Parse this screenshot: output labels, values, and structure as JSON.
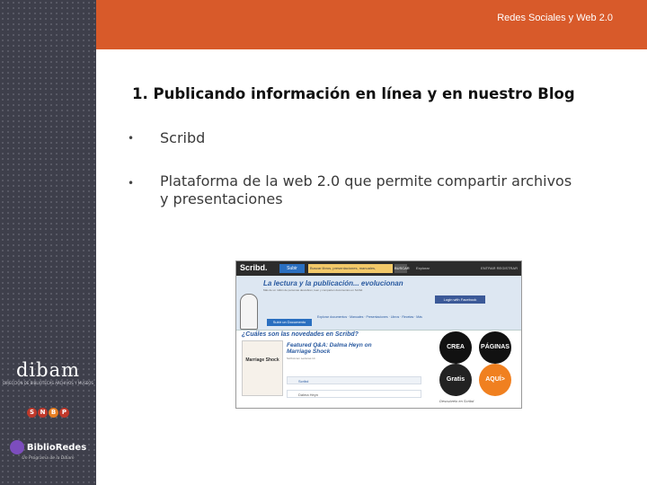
{
  "header": {
    "title": "Redes Sociales y Web 2.0"
  },
  "slide": {
    "title": "1. Publicando información en línea y en nuestro Blog",
    "bullets": [
      {
        "marker": "•",
        "text": "Scribd"
      },
      {
        "marker": "•",
        "text": "Plataforma de la web 2.0 que permite compartir archivos y presentaciones"
      }
    ]
  },
  "sidebar_logos": {
    "dibam": {
      "word": "dibam",
      "sub": "DIRECCIÓN DE BIBLIOTECAS ARCHIVOS Y MUSEOS"
    },
    "snbp": [
      "S",
      "N",
      "B",
      "P"
    ],
    "biblioredes": {
      "word": "BiblioRedes",
      "tagline": "Un Programa de la Dibam"
    }
  },
  "screenshot": {
    "logo": "Scribd.",
    "upload_button": "Subir",
    "search_placeholder": "Buscar libros, presentaciones, manuales, documentos",
    "search_button": "BUSCAR",
    "nav": "Explorar",
    "nav_right": "ENTRAR  REGISTRAR",
    "banner_title": "La lectura y la publicación... evolucionan",
    "banner_text": "Más de un millón de personas descubren, leen y comparten documentos en Scribd.",
    "facebook_button": "Login with Facebook",
    "banner_button": "Subir un Documento",
    "banner_links": "Explorar documentos · Manuales · Presentaciones · Libros · Recetas · Más",
    "section_title": "¿Cuáles son las novedades en Scribd?",
    "book_title": "Marriage Shock",
    "featured_title": "Featured Q&A: Dalma Heyn on Marriage Shock",
    "featured_meta": "Scribd.com  Lecturas 14",
    "row1": "Scribd",
    "row2": "Dalma Heyn",
    "circles": [
      "CREA",
      "PÁGINAS",
      "Gratis",
      "AQUÍ>"
    ],
    "caption": "Descubrelo en Scribd"
  },
  "colors": {
    "header": "#d85a2a",
    "sidebar": "#3e3f4b"
  }
}
